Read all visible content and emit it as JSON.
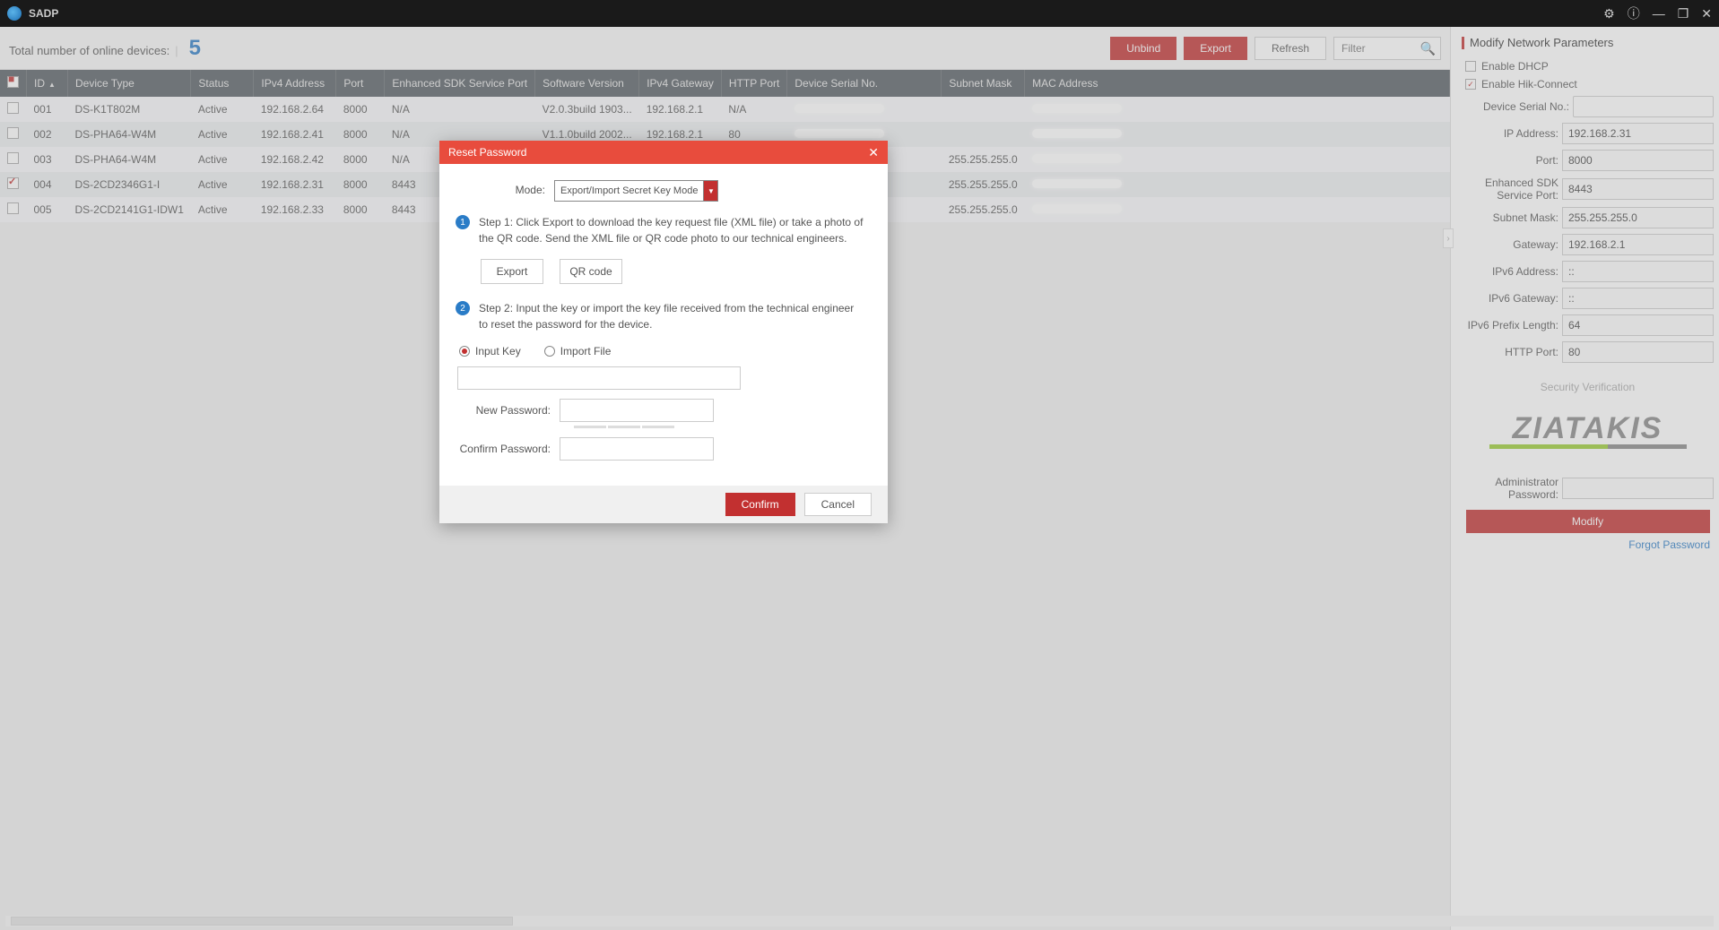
{
  "titlebar": {
    "title": "SADP"
  },
  "toolbar": {
    "total_label": "Total number of online devices:",
    "count": "5",
    "unbind": "Unbind",
    "export": "Export",
    "refresh": "Refresh",
    "filter_placeholder": "Filter"
  },
  "table": {
    "headers": {
      "id": "ID",
      "device_type": "Device Type",
      "status": "Status",
      "ipv4": "IPv4 Address",
      "port": "Port",
      "sdk_port": "Enhanced SDK Service Port",
      "sw_version": "Software Version",
      "gateway": "IPv4 Gateway",
      "http_port": "HTTP Port",
      "serial": "Device Serial No.",
      "subnet": "Subnet Mask",
      "mac": "MAC Address"
    },
    "rows": [
      {
        "checked": false,
        "id": "001",
        "type": "DS-K1T802M",
        "status": "Active",
        "ip": "192.168.2.64",
        "port": "8000",
        "sdk": "N/A",
        "sw": "V2.0.3build 1903...",
        "gw": "192.168.2.1",
        "http": "N/A",
        "serial": "",
        "subnet": "",
        "mac": ""
      },
      {
        "checked": false,
        "id": "002",
        "type": "DS-PHA64-W4M",
        "status": "Active",
        "ip": "192.168.2.41",
        "port": "8000",
        "sdk": "N/A",
        "sw": "V1.1.0build 2002...",
        "gw": "192.168.2.1",
        "http": "80",
        "serial": "",
        "subnet": "",
        "mac": ""
      },
      {
        "checked": false,
        "id": "003",
        "type": "DS-PHA64-W4M",
        "status": "Active",
        "ip": "192.168.2.42",
        "port": "8000",
        "sdk": "N/A",
        "sw": "",
        "gw": "",
        "http": "",
        "serial": "",
        "subnet": "255.255.255.0",
        "mac": ""
      },
      {
        "checked": true,
        "id": "004",
        "type": "DS-2CD2346G1-I",
        "status": "Active",
        "ip": "192.168.2.31",
        "port": "8000",
        "sdk": "8443",
        "sw": "",
        "gw": "",
        "http": "",
        "serial": "...",
        "subnet": "255.255.255.0",
        "mac": ""
      },
      {
        "checked": false,
        "id": "005",
        "type": "DS-2CD2141G1-IDW1",
        "status": "Active",
        "ip": "192.168.2.33",
        "port": "8000",
        "sdk": "8443",
        "sw": "",
        "gw": "",
        "http": "",
        "serial": "",
        "subnet": "255.255.255.0",
        "mac": ""
      }
    ]
  },
  "rightpanel": {
    "title": "Modify Network Parameters",
    "enable_dhcp": "Enable DHCP",
    "enable_hik": "Enable Hik-Connect",
    "fields": {
      "serial_l": "Device Serial No.:",
      "ip_l": "IP Address:",
      "ip_v": "192.168.2.31",
      "port_l": "Port:",
      "port_v": "8000",
      "sdk_l": "Enhanced SDK Service Port:",
      "sdk_v": "8443",
      "subnet_l": "Subnet Mask:",
      "subnet_v": "255.255.255.0",
      "gw_l": "Gateway:",
      "gw_v": "192.168.2.1",
      "ipv6a_l": "IPv6 Address:",
      "ipv6a_v": "::",
      "ipv6g_l": "IPv6 Gateway:",
      "ipv6g_v": "::",
      "ipv6p_l": "IPv6 Prefix Length:",
      "ipv6p_v": "64",
      "http_l": "HTTP Port:",
      "http_v": "80",
      "admin_l": "Administrator Password:"
    },
    "sec_verify": "Security Verification",
    "logo": "ZIATAKIS",
    "modify": "Modify",
    "forgot": "Forgot Password"
  },
  "modal": {
    "title": "Reset Password",
    "mode_label": "Mode:",
    "mode_value": "Export/Import Secret Key Mode",
    "step1": "Step 1: Click Export to download the key request file (XML file) or take a photo of the QR code. Send the XML file or QR code photo to our technical engineers.",
    "export_btn": "Export",
    "qr_btn": "QR code",
    "step2": "Step 2: Input the key or import the key file received from the technical engineer to reset the password for the device.",
    "input_key": "Input Key",
    "import_file": "Import File",
    "new_pw": "New Password:",
    "confirm_pw": "Confirm Password:",
    "confirm": "Confirm",
    "cancel": "Cancel"
  }
}
